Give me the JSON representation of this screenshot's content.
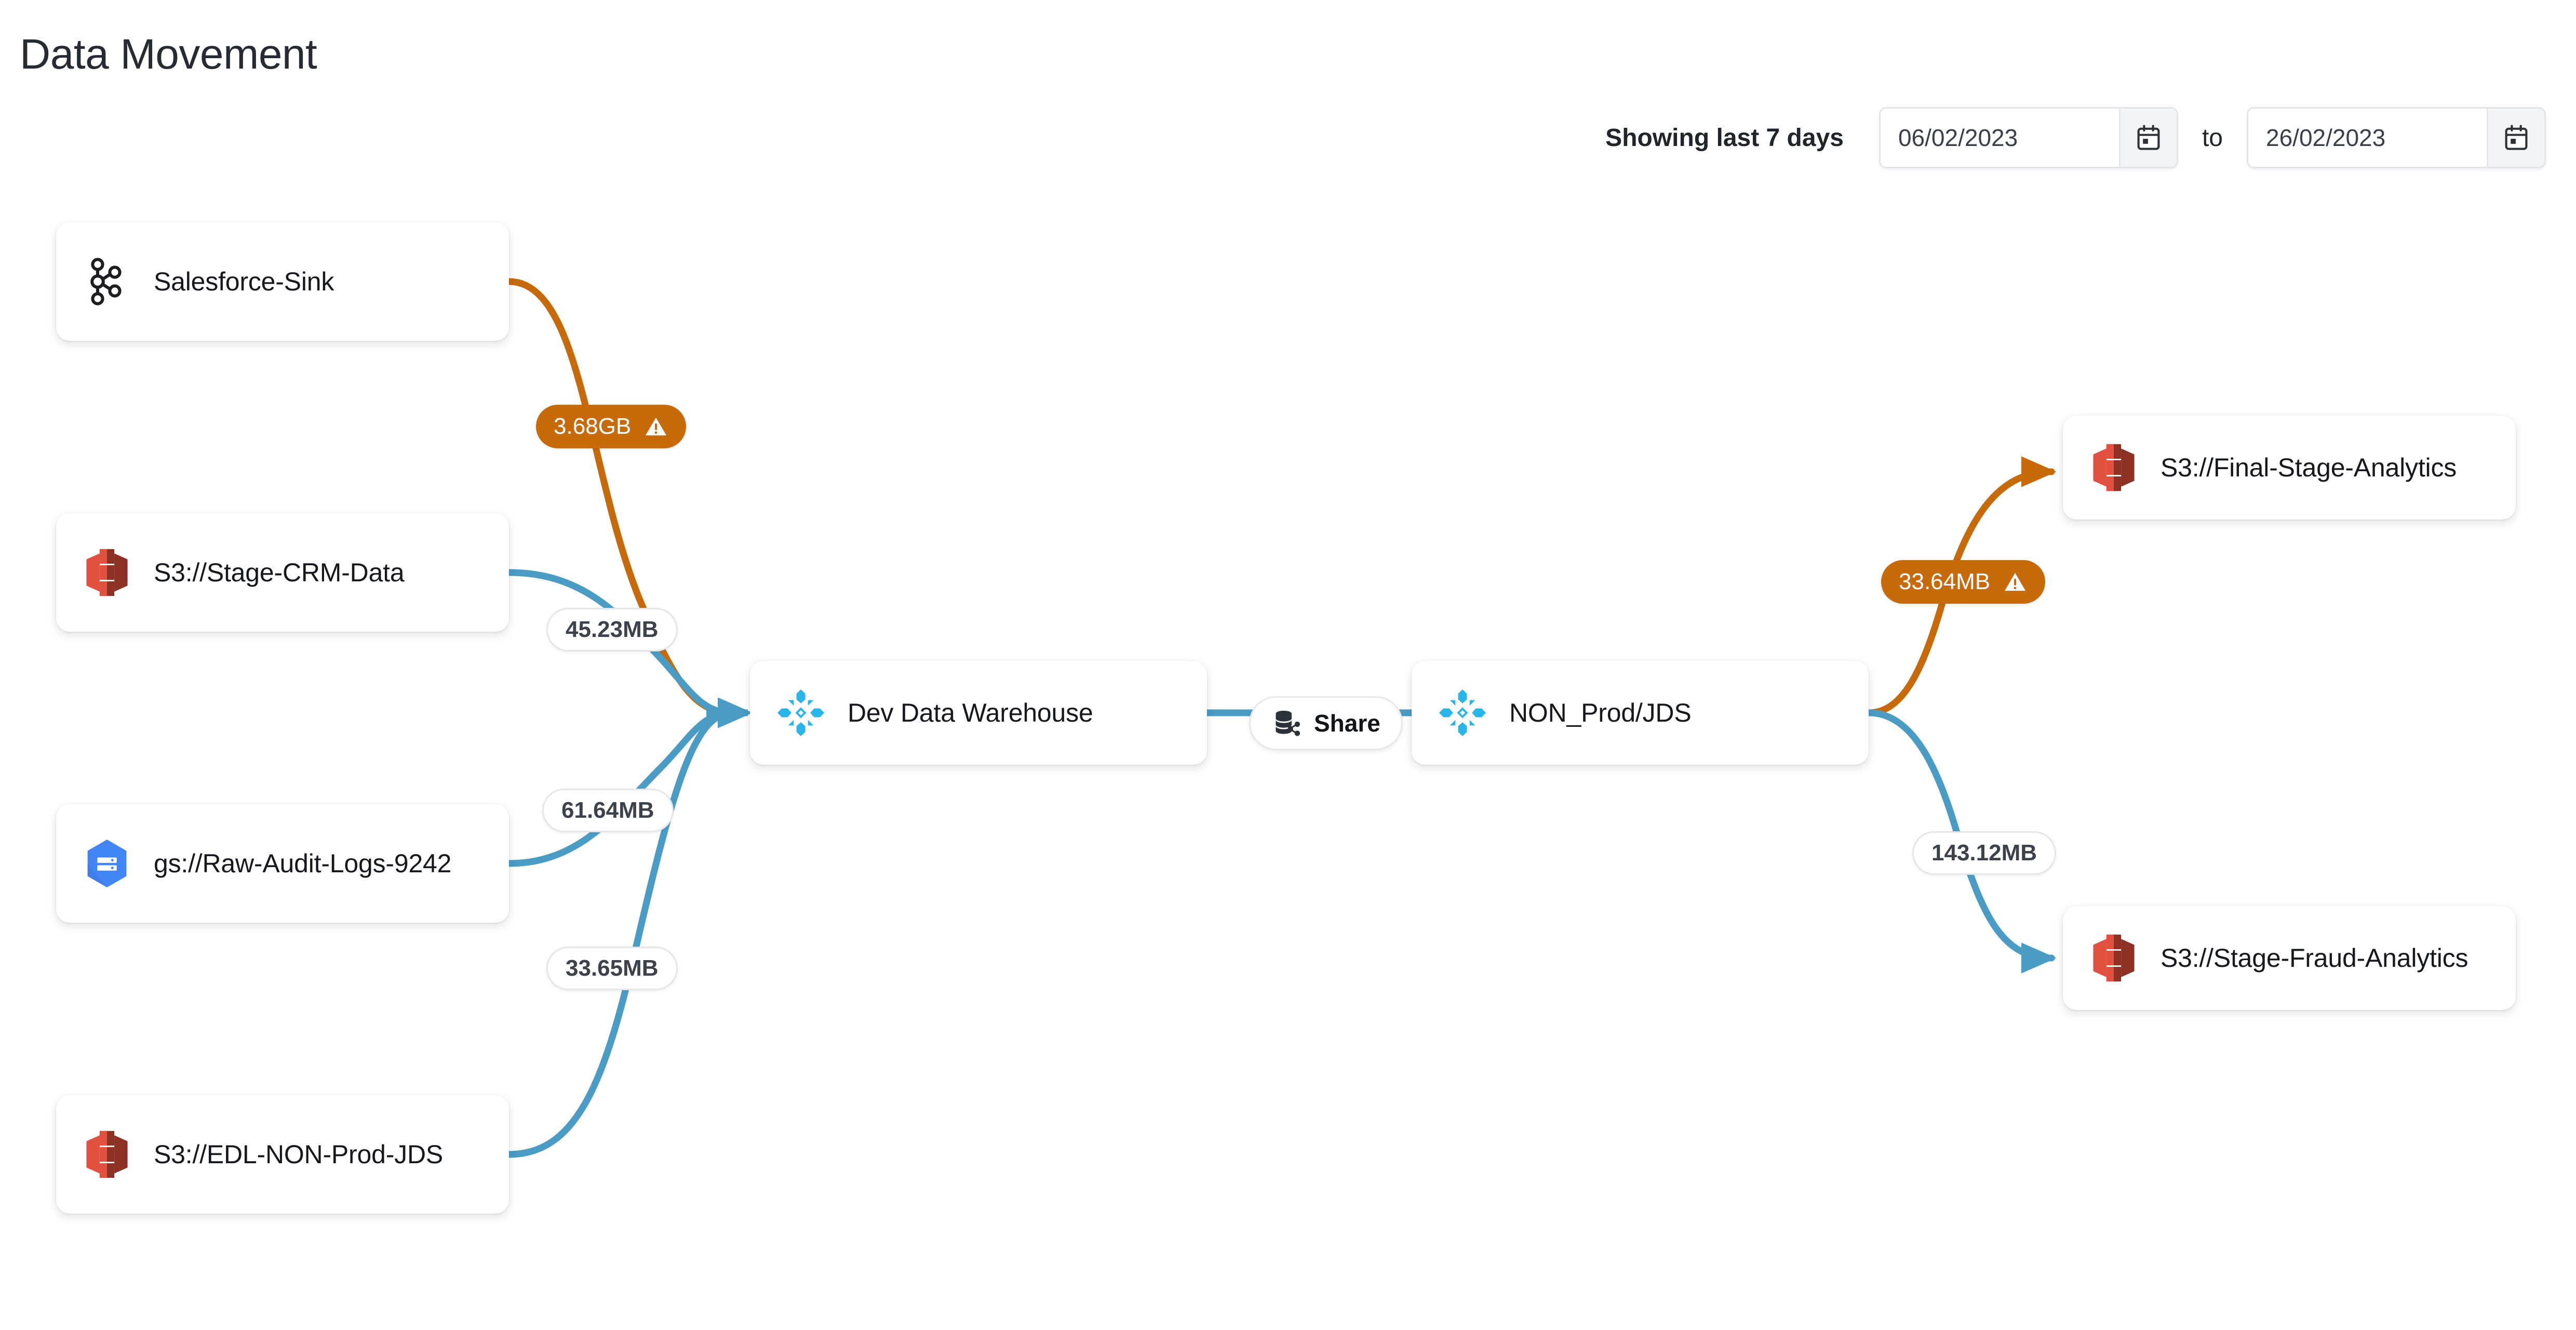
{
  "header": {
    "title": "Data Movement",
    "range_label": "Showing last 7 days",
    "date_from": "06/02/2023",
    "separator": "to",
    "date_to": "26/02/2023",
    "from_calendar_icon": "calendar-icon",
    "to_calendar_icon": "calendar-icon"
  },
  "colors": {
    "edge_normal": "#4a9cc5",
    "edge_warning": "#c76a0c",
    "badge_warning_bg": "#c76a0c",
    "badge_plain_bg": "#ffffff",
    "snowflake_blue": "#29b5e8",
    "s3_red": "#e2503f",
    "s3_red_dark": "#8c3123",
    "gcs_blue": "#4285f4",
    "text_primary": "#15181d",
    "card_bg": "#ffffff"
  },
  "share_link": {
    "label": "Share",
    "icon": "database-share-icon"
  },
  "graph": {
    "nodes": [
      {
        "id": "salesforce-sink",
        "label": "Salesforce-Sink",
        "icon": "kafka-connect-icon"
      },
      {
        "id": "stage-crm-data",
        "label": "S3://Stage-CRM-Data",
        "icon": "aws-s3-icon"
      },
      {
        "id": "raw-audit-logs",
        "label": "gs://Raw-Audit-Logs-9242",
        "icon": "google-cloud-storage-icon"
      },
      {
        "id": "edl-non-prod-jds",
        "label": "S3://EDL-NON-Prod-JDS",
        "icon": "aws-s3-icon"
      },
      {
        "id": "dev-data-warehouse",
        "label": "Dev Data Warehouse",
        "icon": "snowflake-icon"
      },
      {
        "id": "non-prod-jds",
        "label": "NON_Prod/JDS",
        "icon": "snowflake-icon"
      },
      {
        "id": "final-stage-analytics",
        "label": "S3://Final-Stage-Analytics",
        "icon": "aws-s3-icon"
      },
      {
        "id": "stage-fraud-analytics",
        "label": "S3://Stage-Fraud-Analytics",
        "icon": "aws-s3-icon"
      }
    ],
    "edges": [
      {
        "id": "salesforce-to-warehouse",
        "from": "salesforce-sink",
        "to": "dev-data-warehouse",
        "value": "3.68GB",
        "status": "warning",
        "warn_icon": "warning-triangle-icon"
      },
      {
        "id": "stagecrm-to-warehouse",
        "from": "stage-crm-data",
        "to": "dev-data-warehouse",
        "value": "45.23MB",
        "status": "normal"
      },
      {
        "id": "rawaudit-to-warehouse",
        "from": "raw-audit-logs",
        "to": "dev-data-warehouse",
        "value": "61.64MB",
        "status": "normal"
      },
      {
        "id": "edlnonprod-to-warehouse",
        "from": "edl-non-prod-jds",
        "to": "dev-data-warehouse",
        "value": "33.65MB",
        "status": "normal"
      },
      {
        "id": "warehouse-to-nonprod",
        "from": "dev-data-warehouse",
        "to": "non-prod-jds",
        "value": "",
        "status": "share"
      },
      {
        "id": "nonprod-to-finalstage",
        "from": "non-prod-jds",
        "to": "final-stage-analytics",
        "value": "33.64MB",
        "status": "warning",
        "warn_icon": "warning-triangle-icon"
      },
      {
        "id": "nonprod-to-fraud",
        "from": "non-prod-jds",
        "to": "stage-fraud-analytics",
        "value": "143.12MB",
        "status": "normal"
      }
    ]
  }
}
